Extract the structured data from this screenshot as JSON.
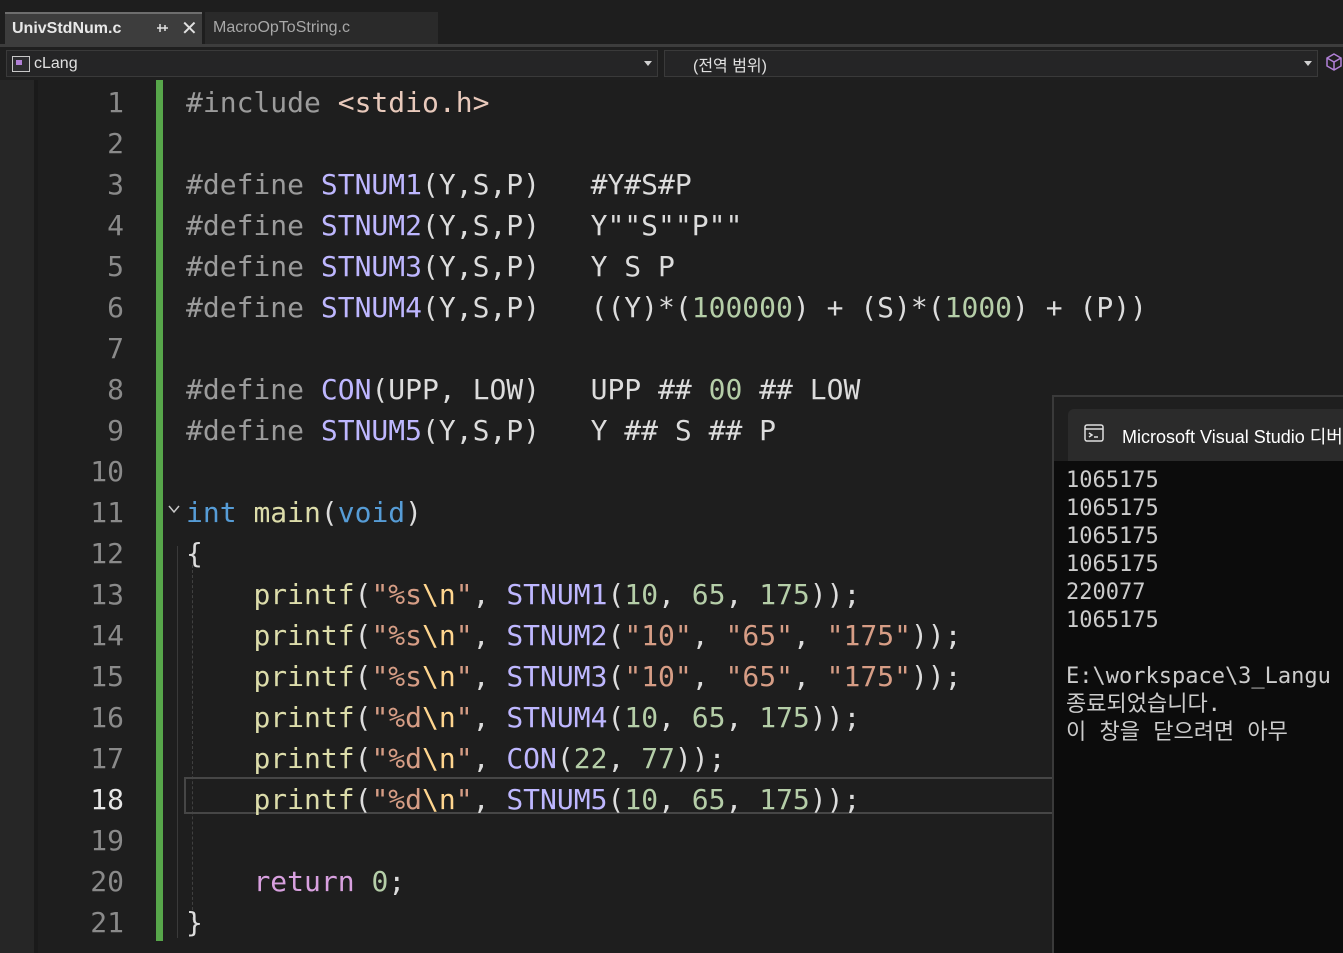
{
  "tabs": [
    {
      "label": "UnivStdNum.c",
      "active": true
    },
    {
      "label": "MacroOpToString.c",
      "active": false
    }
  ],
  "navbar": {
    "project": "cLang",
    "scope": "(전역 범위)"
  },
  "editor": {
    "current_line": 18,
    "line_numbers": [
      "1",
      "2",
      "3",
      "4",
      "5",
      "6",
      "7",
      "8",
      "9",
      "10",
      "11",
      "12",
      "13",
      "14",
      "15",
      "16",
      "17",
      "18",
      "19",
      "20",
      "21"
    ],
    "lines": [
      [
        [
          "pp",
          "#include "
        ],
        [
          "inc",
          "<stdio.h>"
        ]
      ],
      [],
      [
        [
          "pp",
          "#define "
        ],
        [
          "macro",
          "STNUM1"
        ],
        [
          "punc",
          "(Y,S,P)   #Y#S#P"
        ]
      ],
      [
        [
          "pp",
          "#define "
        ],
        [
          "macro",
          "STNUM2"
        ],
        [
          "punc",
          "(Y,S,P)   Y\"\"S\"\"P\"\""
        ]
      ],
      [
        [
          "pp",
          "#define "
        ],
        [
          "macro",
          "STNUM3"
        ],
        [
          "punc",
          "(Y,S,P)   Y S P"
        ]
      ],
      [
        [
          "pp",
          "#define "
        ],
        [
          "macro",
          "STNUM4"
        ],
        [
          "punc",
          "(Y,S,P)   ((Y)*("
        ],
        [
          "num",
          "100000"
        ],
        [
          "punc",
          ") + (S)*("
        ],
        [
          "num",
          "1000"
        ],
        [
          "punc",
          ") + (P))"
        ]
      ],
      [],
      [
        [
          "pp",
          "#define "
        ],
        [
          "macro",
          "CON"
        ],
        [
          "punc",
          "(UPP, LOW)   UPP ## "
        ],
        [
          "num",
          "00"
        ],
        [
          "punc",
          " ## LOW"
        ]
      ],
      [
        [
          "pp",
          "#define "
        ],
        [
          "macro",
          "STNUM5"
        ],
        [
          "punc",
          "(Y,S,P)   Y ## S ## P"
        ]
      ],
      [],
      [
        [
          "kw",
          "int"
        ],
        [
          "punc",
          " "
        ],
        [
          "fn",
          "main"
        ],
        [
          "punc",
          "("
        ],
        [
          "kw",
          "void"
        ],
        [
          "punc",
          ")"
        ]
      ],
      [
        [
          "punc",
          "{"
        ]
      ],
      [
        [
          "punc",
          "    "
        ],
        [
          "fn",
          "printf"
        ],
        [
          "punc",
          "("
        ],
        [
          "str",
          "\"%s"
        ],
        [
          "esc",
          "\\n"
        ],
        [
          "str",
          "\""
        ],
        [
          "punc",
          ", "
        ],
        [
          "macro",
          "STNUM1"
        ],
        [
          "punc",
          "("
        ],
        [
          "num",
          "10"
        ],
        [
          "punc",
          ", "
        ],
        [
          "num",
          "65"
        ],
        [
          "punc",
          ", "
        ],
        [
          "num",
          "175"
        ],
        [
          "punc",
          "));"
        ]
      ],
      [
        [
          "punc",
          "    "
        ],
        [
          "fn",
          "printf"
        ],
        [
          "punc",
          "("
        ],
        [
          "str",
          "\"%s"
        ],
        [
          "esc",
          "\\n"
        ],
        [
          "str",
          "\""
        ],
        [
          "punc",
          ", "
        ],
        [
          "macro",
          "STNUM2"
        ],
        [
          "punc",
          "("
        ],
        [
          "str",
          "\"10\""
        ],
        [
          "punc",
          ", "
        ],
        [
          "str",
          "\"65\""
        ],
        [
          "punc",
          ", "
        ],
        [
          "str",
          "\"175\""
        ],
        [
          "punc",
          "));"
        ]
      ],
      [
        [
          "punc",
          "    "
        ],
        [
          "fn",
          "printf"
        ],
        [
          "punc",
          "("
        ],
        [
          "str",
          "\"%s"
        ],
        [
          "esc",
          "\\n"
        ],
        [
          "str",
          "\""
        ],
        [
          "punc",
          ", "
        ],
        [
          "macro",
          "STNUM3"
        ],
        [
          "punc",
          "("
        ],
        [
          "str",
          "\"10\""
        ],
        [
          "punc",
          ", "
        ],
        [
          "str",
          "\"65\""
        ],
        [
          "punc",
          ", "
        ],
        [
          "str",
          "\"175\""
        ],
        [
          "punc",
          "));"
        ]
      ],
      [
        [
          "punc",
          "    "
        ],
        [
          "fn",
          "printf"
        ],
        [
          "punc",
          "("
        ],
        [
          "str",
          "\"%d"
        ],
        [
          "esc",
          "\\n"
        ],
        [
          "str",
          "\""
        ],
        [
          "punc",
          ", "
        ],
        [
          "macro",
          "STNUM4"
        ],
        [
          "punc",
          "("
        ],
        [
          "num",
          "10"
        ],
        [
          "punc",
          ", "
        ],
        [
          "num",
          "65"
        ],
        [
          "punc",
          ", "
        ],
        [
          "num",
          "175"
        ],
        [
          "punc",
          "));"
        ]
      ],
      [
        [
          "punc",
          "    "
        ],
        [
          "fn",
          "printf"
        ],
        [
          "punc",
          "("
        ],
        [
          "str",
          "\"%d"
        ],
        [
          "esc",
          "\\n"
        ],
        [
          "str",
          "\""
        ],
        [
          "punc",
          ", "
        ],
        [
          "macro",
          "CON"
        ],
        [
          "punc",
          "("
        ],
        [
          "num",
          "22"
        ],
        [
          "punc",
          ", "
        ],
        [
          "num",
          "77"
        ],
        [
          "punc",
          "));"
        ]
      ],
      [
        [
          "punc",
          "    "
        ],
        [
          "fn",
          "printf"
        ],
        [
          "punc",
          "("
        ],
        [
          "str",
          "\"%d"
        ],
        [
          "esc",
          "\\n"
        ],
        [
          "str",
          "\""
        ],
        [
          "punc",
          ", "
        ],
        [
          "macro",
          "STNUM5"
        ],
        [
          "punc",
          "("
        ],
        [
          "num",
          "10"
        ],
        [
          "punc",
          ", "
        ],
        [
          "num",
          "65"
        ],
        [
          "punc",
          ", "
        ],
        [
          "num",
          "175"
        ],
        [
          "punc",
          "));"
        ]
      ],
      [],
      [
        [
          "punc",
          "    "
        ],
        [
          "ret",
          "return"
        ],
        [
          "punc",
          " "
        ],
        [
          "num",
          "0"
        ],
        [
          "punc",
          ";"
        ]
      ],
      [
        [
          "punc",
          "}"
        ]
      ]
    ]
  },
  "console": {
    "title": "Microsoft Visual Studio 디버",
    "output": [
      "1065175",
      "1065175",
      "1065175",
      "1065175",
      "220077",
      "1065175",
      "",
      "E:\\workspace\\3_Langu",
      "종료되었습니다.",
      "이 창을 닫으려면 아무"
    ]
  },
  "colors": {
    "preprocessor": "#9b9b9b",
    "include_path": "#e8c9bb",
    "macro": "#beb7ff",
    "keyword": "#569cd6",
    "function": "#dcdcaa",
    "string": "#d69d85",
    "escape": "#ffd68f",
    "number": "#b5cea8",
    "control_keyword": "#d8a0df",
    "change_bar": "#57a64a"
  }
}
